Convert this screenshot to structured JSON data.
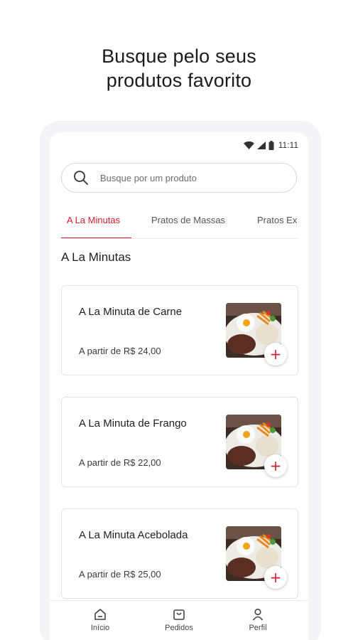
{
  "headline": {
    "line1": "Busque pelo seus",
    "line2": "produtos favorito"
  },
  "statusbar": {
    "time": "11:11",
    "icons": [
      "wifi-icon",
      "signal-icon",
      "battery-icon"
    ]
  },
  "search": {
    "placeholder": "Busque por um produto",
    "icon": "search-icon"
  },
  "tabs": [
    {
      "label": "A La Minutas",
      "active": true
    },
    {
      "label": "Pratos de Massas",
      "active": false
    },
    {
      "label": "Pratos Ex",
      "active": false
    }
  ],
  "section": {
    "title": "A La Minutas"
  },
  "products": [
    {
      "name": "A La Minuta de Carne",
      "price": "A partir de R$ 24,00",
      "add_label": "+"
    },
    {
      "name": "A La Minuta de Frango",
      "price": "A partir de R$ 22,00",
      "add_label": "+"
    },
    {
      "name": "A La Minuta Acebolada",
      "price": "A partir de R$ 25,00",
      "add_label": "+"
    }
  ],
  "bottomnav": [
    {
      "label": "Início",
      "icon": "home-icon"
    },
    {
      "label": "Pedidos",
      "icon": "bag-icon"
    },
    {
      "label": "Perfil",
      "icon": "person-icon"
    }
  ],
  "colors": {
    "accent": "#d51f2d",
    "border": "#e4e4e8",
    "text": "#1e1e1e"
  }
}
